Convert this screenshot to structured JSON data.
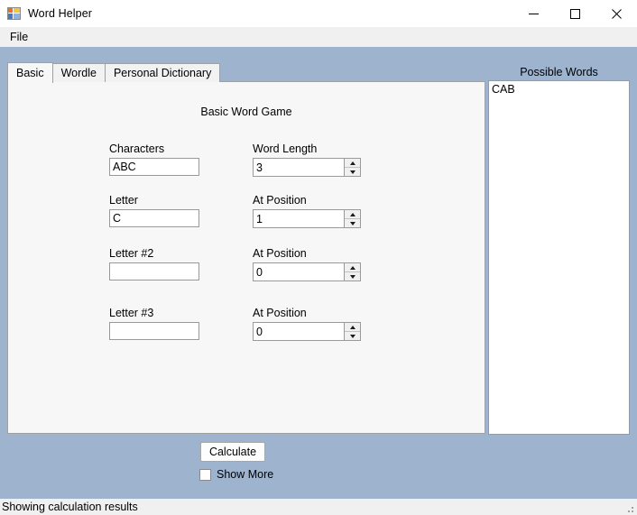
{
  "window": {
    "title": "Word Helper",
    "icon": "app-grid-icon",
    "controls": {
      "minimize": "minimize-icon",
      "maximize": "maximize-icon",
      "close": "close-icon"
    }
  },
  "menubar": {
    "items": [
      {
        "label": "File"
      }
    ]
  },
  "tabs": [
    {
      "label": "Basic",
      "active": true
    },
    {
      "label": "Wordle",
      "active": false
    },
    {
      "label": "Personal Dictionary",
      "active": false
    }
  ],
  "basic_tab": {
    "heading": "Basic Word Game",
    "fields": {
      "characters": {
        "label": "Characters",
        "value": "ABC"
      },
      "word_length": {
        "label": "Word Length",
        "value": "3"
      },
      "letter1": {
        "label": "Letter",
        "value": "C"
      },
      "position1": {
        "label": "At Position",
        "value": "1"
      },
      "letter2": {
        "label": "Letter #2",
        "value": ""
      },
      "position2": {
        "label": "At Position",
        "value": "0"
      },
      "letter3": {
        "label": "Letter #3",
        "value": ""
      },
      "position3": {
        "label": "At Position",
        "value": "0"
      }
    }
  },
  "possible_words": {
    "label": "Possible Words",
    "items": [
      "CAB"
    ]
  },
  "actions": {
    "calculate_label": "Calculate",
    "show_more_label": "Show More",
    "show_more_checked": false
  },
  "statusbar": {
    "text": "Showing calculation results"
  },
  "colors": {
    "form_background": "#9db3ce",
    "panel_background": "#f7f7f7",
    "chrome_background": "#f0f0f0",
    "input_background": "#ffffff",
    "border": "#9a9a9a"
  }
}
